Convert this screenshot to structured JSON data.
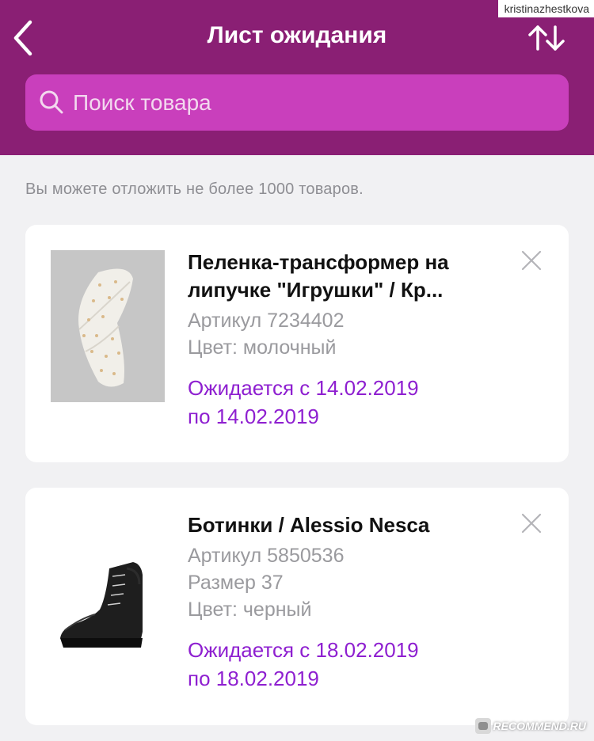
{
  "header": {
    "title": "Лист ожидания",
    "back_icon": "chevron-left-icon",
    "sort_icon": "sort-arrows-icon",
    "background": "#8a1f74"
  },
  "watermark": {
    "username": "kristinazhestkova",
    "badge": "RECOMMEND.RU"
  },
  "search": {
    "placeholder": "Поиск товара",
    "value": "",
    "icon": "search-icon",
    "background": "#c93fbc"
  },
  "notice": "Вы можете отложить не более 1000 товаров.",
  "items": [
    {
      "name": "Пеленка-трансформер на липучке \"Игрушки\" / Кр...",
      "article": "Артикул 7234402",
      "attrs": [
        "Цвет: молочный"
      ],
      "expected_line1": "Ожидается с 14.02.2019",
      "expected_line2": "по 14.02.2019",
      "image": "swaddle-photo"
    },
    {
      "name": "Ботинки / Alessio Nesca",
      "article": "Артикул 5850536",
      "attrs": [
        "Размер 37",
        "Цвет: черный"
      ],
      "expected_line1": "Ожидается с 18.02.2019",
      "expected_line2": "по 18.02.2019",
      "image": "boot-photo"
    }
  ],
  "colors": {
    "accent": "#8e1fd0",
    "page_background": "#f1f1f3"
  }
}
